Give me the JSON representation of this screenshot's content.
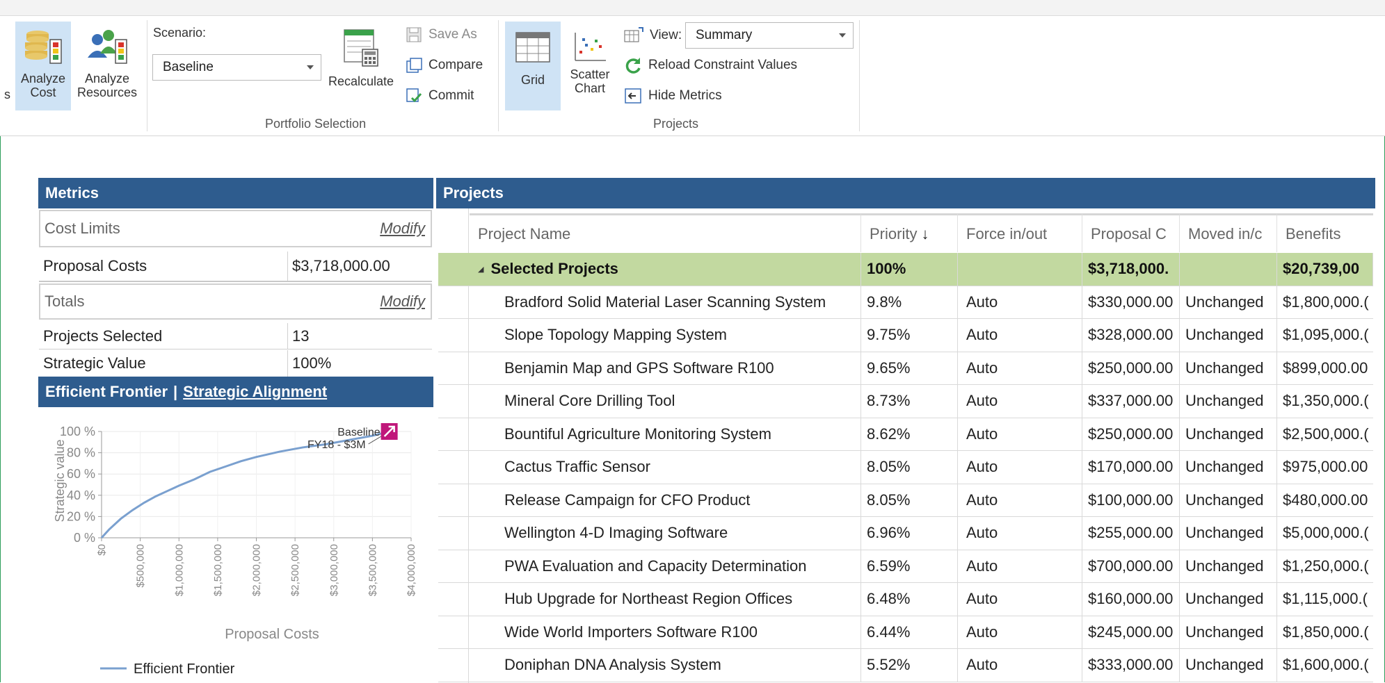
{
  "ribbon": {
    "analyze_cost": "Analyze\nCost",
    "analyze_cost_l1": "Analyze",
    "analyze_cost_l2": "Cost",
    "analyze_resources_l1": "Analyze",
    "analyze_resources_l2": "Resources",
    "left_edge_fragment": "s",
    "scenario_label": "Scenario:",
    "scenario_value": "Baseline",
    "recalculate": "Recalculate",
    "save_as": "Save As",
    "compare": "Compare",
    "commit": "Commit",
    "portfolio_group": "Portfolio Selection",
    "grid": "Grid",
    "scatter_l1": "Scatter",
    "scatter_l2": "Chart",
    "view_label": "View:",
    "view_value": "Summary",
    "reload": "Reload Constraint Values",
    "hide_metrics": "Hide Metrics",
    "projects_group": "Projects"
  },
  "metrics": {
    "header": "Metrics",
    "cost_limits": "Cost Limits",
    "modify": "Modify",
    "proposal_costs_label": "Proposal Costs",
    "proposal_costs_value": "$3,718,000.00",
    "totals": "Totals",
    "projects_selected_label": "Projects Selected",
    "projects_selected_value": "13",
    "strategic_value_label": "Strategic Value",
    "strategic_value_value": "100%"
  },
  "frontier": {
    "header_a": "Efficient Frontier",
    "header_sep": "|",
    "header_b": "Strategic Alignment"
  },
  "chart_data": {
    "type": "line",
    "title": "",
    "xlabel": "Proposal Costs",
    "ylabel": "Strategic value",
    "xlim": [
      0,
      4000000
    ],
    "ylim": [
      0,
      100
    ],
    "x_ticks": [
      "$0",
      "$500,000",
      "$1,000,000",
      "$1,500,000",
      "$2,000,000",
      "$2,500,000",
      "$3,000,000",
      "$3,500,000",
      "$4,000,000"
    ],
    "y_ticks": [
      "0 %",
      "20 %",
      "40 %",
      "60 %",
      "80 %",
      "100 %"
    ],
    "series": [
      {
        "name": "Efficient Frontier",
        "color": "#7aa0cf",
        "x": [
          0,
          100000,
          250000,
          400000,
          550000,
          700000,
          850000,
          1000000,
          1200000,
          1400000,
          1600000,
          1800000,
          2000000,
          2300000,
          2600000,
          2900000,
          3200000,
          3500000,
          3718000
        ],
        "y": [
          0,
          8,
          18,
          26,
          33,
          39,
          44,
          49,
          55,
          62,
          67,
          72,
          76,
          81,
          85,
          88,
          92,
          96,
          100
        ]
      }
    ],
    "annotations": [
      {
        "label_line1": "Baseline",
        "label_line2": "FY18 - $3M",
        "x": 3718000,
        "y": 100,
        "marker_color": "#c0177a"
      }
    ]
  },
  "projects": {
    "header": "Projects",
    "columns": [
      "Project Name",
      "Priority",
      "Force in/out",
      "Proposal C",
      "Moved in/c",
      "Benefits"
    ],
    "sort_indicator": "↓",
    "group": {
      "name": "Selected Projects",
      "priority": "100%",
      "force": "",
      "cost": "$3,718,000.",
      "moved": "",
      "benefits": "$20,739,00"
    },
    "rows": [
      {
        "name": "Bradford Solid Material Laser Scanning System",
        "priority": "9.8%",
        "force": "Auto",
        "cost": "$330,000.00",
        "moved": "Unchanged",
        "benefits": "$1,800,000.("
      },
      {
        "name": "Slope Topology Mapping System",
        "priority": "9.75%",
        "force": "Auto",
        "cost": "$328,000.00",
        "moved": "Unchanged",
        "benefits": "$1,095,000.("
      },
      {
        "name": "Benjamin Map and GPS Software R100",
        "priority": "9.65%",
        "force": "Auto",
        "cost": "$250,000.00",
        "moved": "Unchanged",
        "benefits": "$899,000.00"
      },
      {
        "name": "Mineral Core Drilling Tool",
        "priority": "8.73%",
        "force": "Auto",
        "cost": "$337,000.00",
        "moved": "Unchanged",
        "benefits": "$1,350,000.("
      },
      {
        "name": "Bountiful Agriculture Monitoring System",
        "priority": "8.62%",
        "force": "Auto",
        "cost": "$250,000.00",
        "moved": "Unchanged",
        "benefits": "$2,500,000.("
      },
      {
        "name": "Cactus Traffic Sensor",
        "priority": "8.05%",
        "force": "Auto",
        "cost": "$170,000.00",
        "moved": "Unchanged",
        "benefits": "$975,000.00"
      },
      {
        "name": "Release Campaign for CFO Product",
        "priority": "8.05%",
        "force": "Auto",
        "cost": "$100,000.00",
        "moved": "Unchanged",
        "benefits": "$480,000.00"
      },
      {
        "name": "Wellington 4-D Imaging Software",
        "priority": "6.96%",
        "force": "Auto",
        "cost": "$255,000.00",
        "moved": "Unchanged",
        "benefits": "$5,000,000.("
      },
      {
        "name": "PWA Evaluation and Capacity Determination",
        "priority": "6.59%",
        "force": "Auto",
        "cost": "$700,000.00",
        "moved": "Unchanged",
        "benefits": "$1,250,000.("
      },
      {
        "name": "Hub Upgrade for Northeast Region Offices",
        "priority": "6.48%",
        "force": "Auto",
        "cost": "$160,000.00",
        "moved": "Unchanged",
        "benefits": "$1,115,000.("
      },
      {
        "name": "Wide World Importers Software R100",
        "priority": "6.44%",
        "force": "Auto",
        "cost": "$245,000.00",
        "moved": "Unchanged",
        "benefits": "$1,850,000.("
      },
      {
        "name": "Doniphan DNA Analysis System",
        "priority": "5.52%",
        "force": "Auto",
        "cost": "$333,000.00",
        "moved": "Unchanged",
        "benefits": "$1,600,000.("
      }
    ]
  },
  "colors": {
    "header_blue": "#2e5c8e",
    "group_green": "#c2d9a0",
    "active_btn": "#cfe3f5",
    "frontier_line": "#7aa0cf",
    "baseline_marker": "#c0177a"
  }
}
